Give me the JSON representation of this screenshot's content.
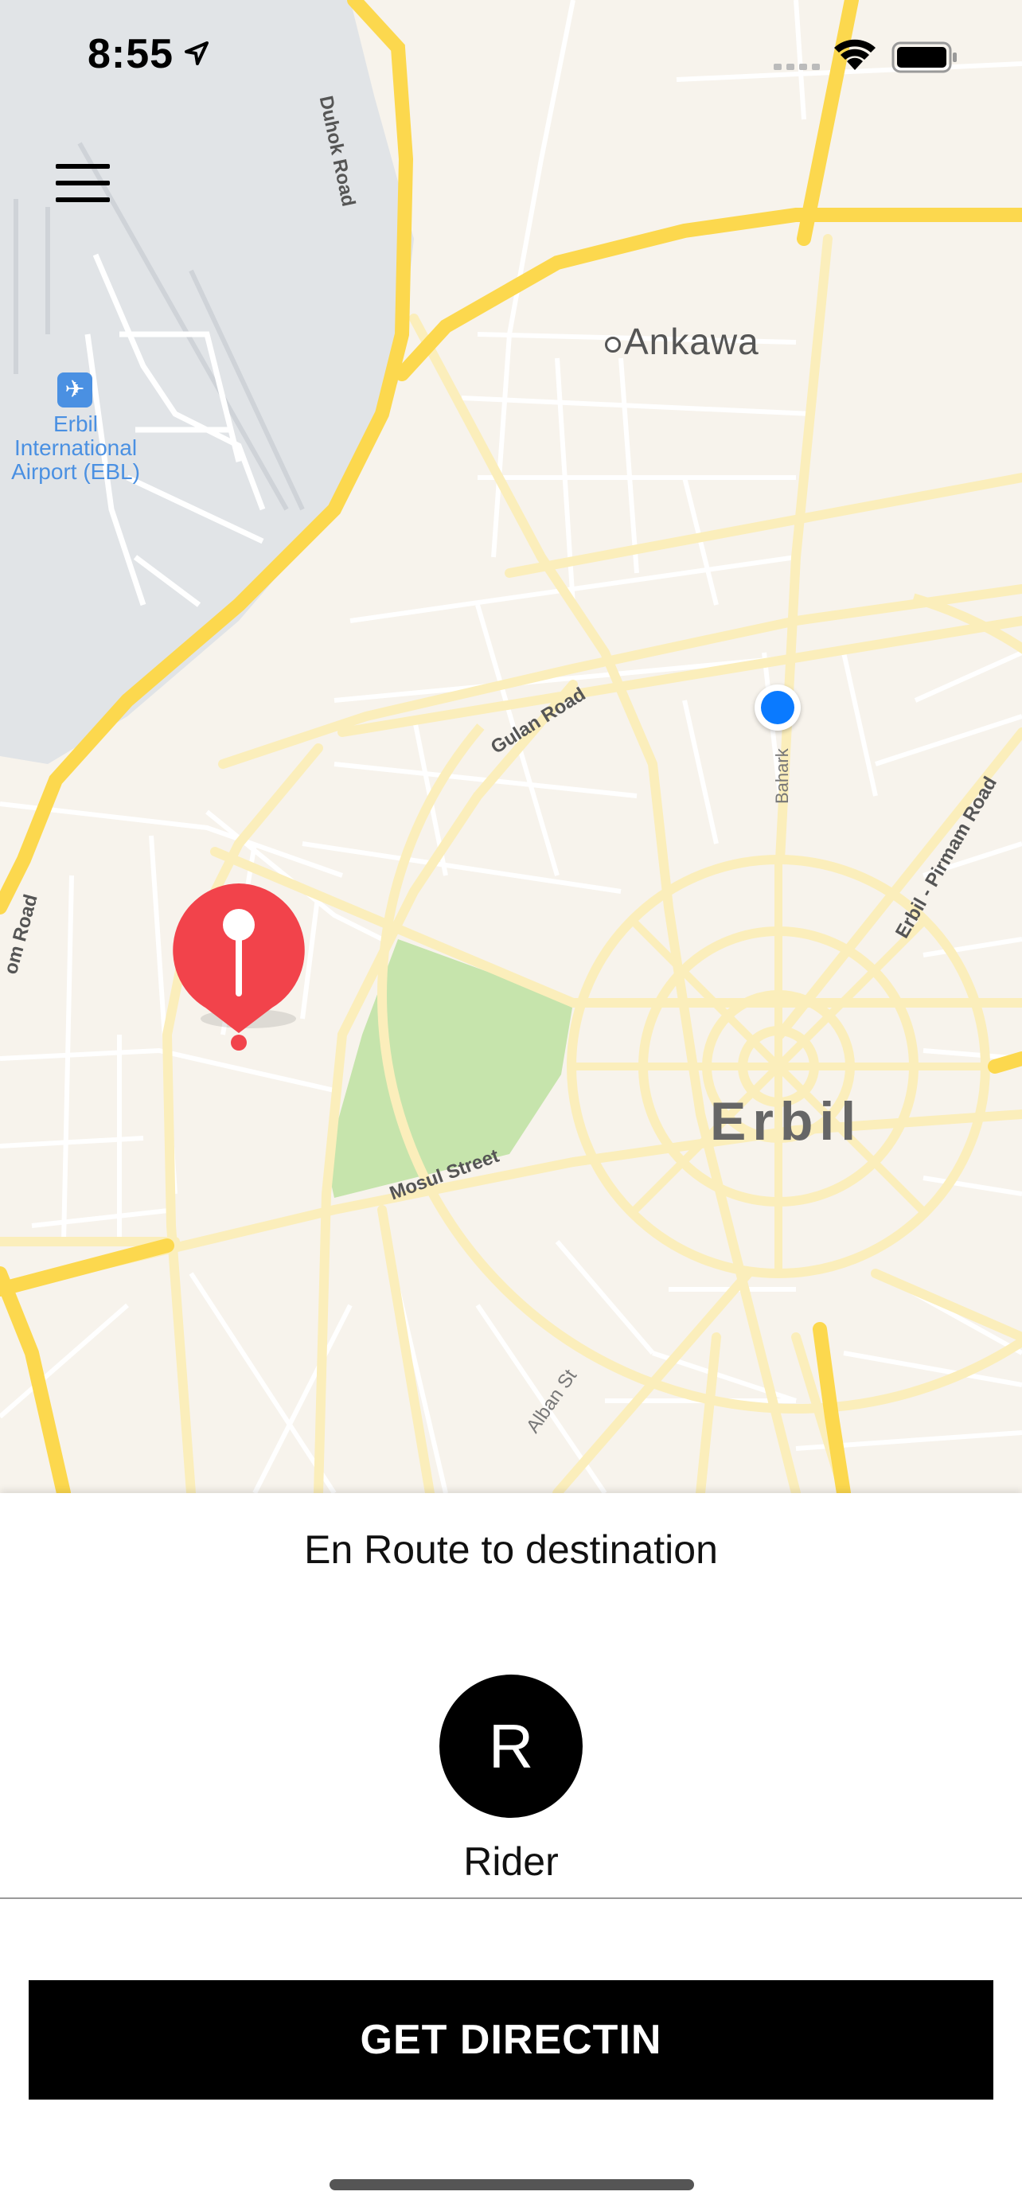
{
  "status_bar": {
    "time": "8:55",
    "icons": [
      "location-arrow-icon",
      "cellular-signal-icon",
      "wifi-icon",
      "battery-icon"
    ]
  },
  "map": {
    "menu_icon": "hamburger-menu-icon",
    "labels": {
      "ankawa": "Ankawa",
      "erbil": "Erbil",
      "airport_line1": "Erbil",
      "airport_line2": "International",
      "airport_line3": "Airport (EBL)",
      "duhok_road": "Duhok Road",
      "gulan_road": "Gulan Road",
      "mosul_street": "Mosul Street",
      "alban_st": "Alban St",
      "erbil_pirmam_road": "Erbil - Pirmam Road",
      "bahark": "Bahark",
      "left_road": "om Road"
    },
    "colors": {
      "land": "#f7f3ec",
      "water_airport": "#e1e4e7",
      "major_road": "#fcd84e",
      "minor_road": "#fbeebb",
      "street": "#ffffff",
      "park": "#c6e4ac",
      "user_location": "#0a7aff",
      "destination_pin": "#f2434b"
    },
    "markers": [
      "user-location-dot",
      "destination-pin"
    ]
  },
  "sheet": {
    "status_text": "En Route to destination",
    "rider_initial": "R",
    "rider_name": "Rider",
    "action_button_label": "GET DIRECTIN"
  }
}
